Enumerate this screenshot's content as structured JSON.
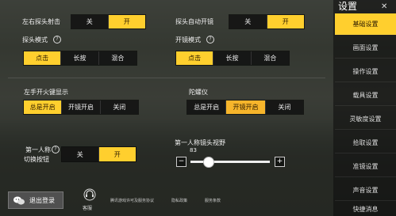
{
  "sidebar": {
    "title": "设置",
    "items": [
      {
        "label": "基础设置",
        "active": true
      },
      {
        "label": "画面设置"
      },
      {
        "label": "操作设置"
      },
      {
        "label": "载具设置"
      },
      {
        "label": "灵敏度设置"
      },
      {
        "label": "拾取设置"
      },
      {
        "label": "准镜设置"
      },
      {
        "label": "声音设置"
      },
      {
        "label": "快捷消息"
      }
    ]
  },
  "settings": {
    "peek_fire": {
      "label": "左右探头射击",
      "options": [
        "关",
        "开"
      ],
      "selected": "开"
    },
    "peek_auto_scope": {
      "label": "探头自动开镜",
      "options": [
        "关",
        "开"
      ],
      "selected": "开"
    },
    "peek_mode": {
      "label": "探头模式",
      "help": "?",
      "options": [
        "点击",
        "长按",
        "混合"
      ],
      "selected": "点击"
    },
    "scope_mode": {
      "label": "开镜模式",
      "help": "?",
      "options": [
        "点击",
        "长按",
        "混合"
      ],
      "selected": "点击"
    },
    "left_fire": {
      "label": "左手开火键显示",
      "options": [
        "总是开启",
        "开镜开启",
        "关闭"
      ],
      "selected": "总是开启"
    },
    "gyro": {
      "label": "陀螺仪",
      "options": [
        "总是开启",
        "开镜开启",
        "关闭"
      ],
      "selected": "开镜开启"
    },
    "fpp_toggle": {
      "label_line1": "第一人称",
      "label_line2": "切换按钮",
      "help": "?",
      "options": [
        "关",
        "开"
      ],
      "selected": "开"
    },
    "fpp_fov": {
      "label": "第一人称镜头视野",
      "value": "83",
      "minus": "−",
      "plus": "+",
      "fraction": 0.22
    }
  },
  "footer": {
    "logout": "退出登录",
    "service_label": "客服",
    "links": [
      "腾讯游戏许可及服务协议",
      "隐私政策",
      "服务条款"
    ]
  },
  "colors": {
    "accent": "#ffcf2e"
  }
}
